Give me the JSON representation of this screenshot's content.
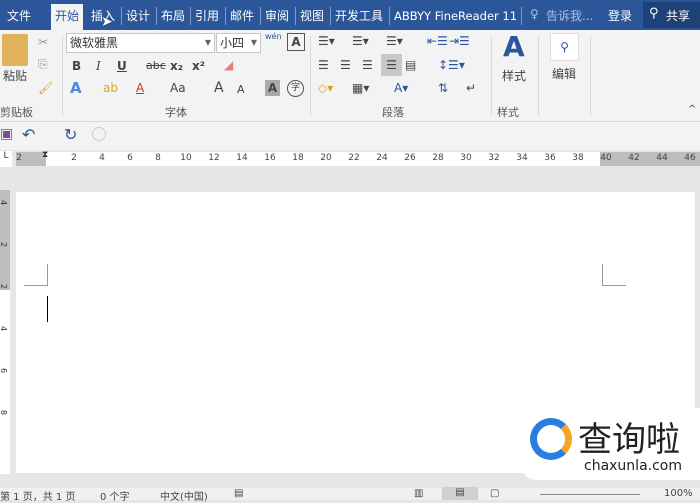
{
  "tabs": [
    "文件",
    "开始",
    "插入",
    "设计",
    "布局",
    "引用",
    "邮件",
    "审阅",
    "视图",
    "开发工具",
    "ABBYY FineReader 11"
  ],
  "active_tab": "开始",
  "tell_me": "告诉我...",
  "signin": "登录",
  "share": "共享",
  "clipboard": {
    "paste": "粘贴",
    "label": "剪贴板"
  },
  "font": {
    "name": "微软雅黑",
    "size": "小四",
    "bold": "B",
    "italic": "I",
    "underline": "U",
    "strike": "abc",
    "sub": "x₂",
    "sup": "x²",
    "phonetic": "wén",
    "border_char": "A",
    "grow": "A",
    "shrink": "A",
    "case": "Aa",
    "shade": "A",
    "enclose": "字",
    "label": "字体"
  },
  "paragraph": {
    "label": "段落"
  },
  "styles": {
    "button": "样式",
    "label": "样式"
  },
  "editing": {
    "button": "编辑"
  },
  "ruler": {
    "left": [
      "2"
    ],
    "ticks": [
      "2",
      "4",
      "6",
      "8",
      "10",
      "12",
      "14",
      "16",
      "18",
      "20",
      "22",
      "24",
      "26",
      "28",
      "30",
      "32",
      "34",
      "36",
      "38",
      "40",
      "42",
      "44",
      "46"
    ]
  },
  "vruler": [
    "4",
    "2",
    "2",
    "4",
    "6",
    "8"
  ],
  "status": {
    "page": "第 1 页，共 1 页",
    "words": "0 个字",
    "lang": "中文(中国)",
    "zoom": "100%"
  },
  "watermark": {
    "name": "查询啦",
    "url": "chaxunla.com"
  },
  "colors": {
    "brand": "#2b579a",
    "ribbon": "#f3f3f3"
  }
}
